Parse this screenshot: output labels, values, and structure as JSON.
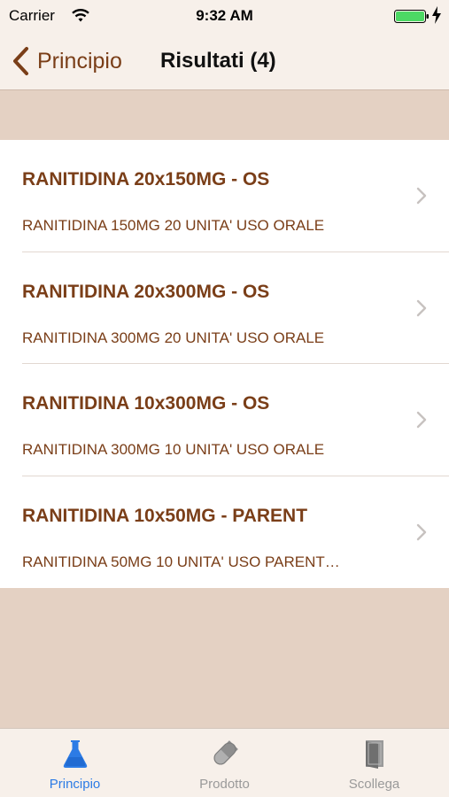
{
  "status_bar": {
    "carrier": "Carrier",
    "time": "9:32 AM"
  },
  "nav": {
    "back_label": "Principio",
    "title": "Risultati (4)"
  },
  "results": [
    {
      "title": "RANITIDINA 20x150MG - OS",
      "subtitle": "RANITIDINA 150MG 20 UNITA' USO ORALE"
    },
    {
      "title": "RANITIDINA 20x300MG - OS",
      "subtitle": "RANITIDINA 300MG 20 UNITA' USO ORALE"
    },
    {
      "title": "RANITIDINA 10x300MG - OS",
      "subtitle": "RANITIDINA 300MG 10 UNITA' USO ORALE"
    },
    {
      "title": "RANITIDINA 10x50MG - PARENT",
      "subtitle": "RANITIDINA 50MG 10 UNITA' USO PARENT…"
    }
  ],
  "tabs": [
    {
      "label": "Principio",
      "icon": "flask-icon",
      "active": true
    },
    {
      "label": "Prodotto",
      "icon": "pill-icon",
      "active": false
    },
    {
      "label": "Scollega",
      "icon": "door-icon",
      "active": false
    }
  ],
  "colors": {
    "accent": "#7a3e18",
    "background": "#e4d1c3",
    "bar_background": "#f7f0ea",
    "tab_active": "#2c7be5",
    "tab_inactive": "#9a9a9a",
    "battery": "#4cd964"
  }
}
